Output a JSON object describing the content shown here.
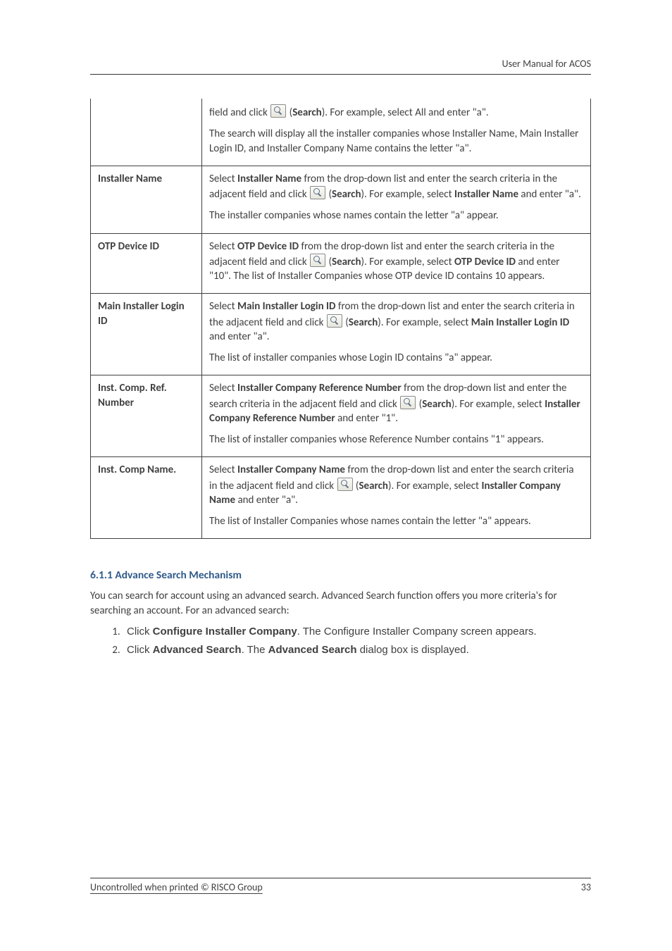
{
  "header": {
    "running_title": "User Manual for ACOS"
  },
  "table": {
    "rows": [
      {
        "label": "",
        "paras": [
          {
            "segs": [
              {
                "t": "field and click "
              },
              {
                "icon": "search"
              },
              {
                "t": " ("
              },
              {
                "b": "Search"
              },
              {
                "t": "). For example, select All and enter \"a\"."
              }
            ]
          },
          {
            "segs": [
              {
                "t": "The search will display all the installer companies whose Installer Name, Main Installer Login ID, and Installer Company Name contains the letter \"a\"."
              }
            ]
          }
        ]
      },
      {
        "label": "Installer Name",
        "paras": [
          {
            "segs": [
              {
                "t": "Select "
              },
              {
                "b": "Installer Name"
              },
              {
                "t": " from the drop-down list and enter the search criteria in the adjacent field and click "
              },
              {
                "icon": "search"
              },
              {
                "t": " ("
              },
              {
                "b": "Search"
              },
              {
                "t": "). For example, select "
              },
              {
                "b": "Installer Name"
              },
              {
                "t": " and enter \"a\"."
              }
            ]
          },
          {
            "segs": [
              {
                "t": "The installer companies whose names contain the letter \"a\" appear."
              }
            ]
          }
        ]
      },
      {
        "label": "OTP Device ID",
        "paras": [
          {
            "segs": [
              {
                "t": "Select "
              },
              {
                "b": "OTP Device ID"
              },
              {
                "t": " from the drop-down list and enter the search criteria in the adjacent field and click "
              },
              {
                "icon": "search"
              },
              {
                "t": " ("
              },
              {
                "b": "Search"
              },
              {
                "t": "). For example, select "
              },
              {
                "b": "OTP Device ID"
              },
              {
                "t": " and enter \"10\". The list of Installer Companies whose OTP device ID contains 10 appears."
              }
            ]
          }
        ]
      },
      {
        "label": "Main Installer Login ID",
        "paras": [
          {
            "segs": [
              {
                "t": "Select "
              },
              {
                "b": "Main Installer Login ID"
              },
              {
                "t": " from the drop-down list and enter the search criteria in the adjacent field and click "
              },
              {
                "icon": "search"
              },
              {
                "t": " ("
              },
              {
                "b": "Search"
              },
              {
                "t": "). For example, select "
              },
              {
                "b": "Main Installer Login ID"
              },
              {
                "t": " and enter \"a\"."
              }
            ]
          },
          {
            "segs": [
              {
                "t": "The list of installer companies whose Login ID contains \"a\" appear."
              }
            ]
          }
        ]
      },
      {
        "label": "Inst. Comp. Ref. Number",
        "paras": [
          {
            "segs": [
              {
                "t": "Select "
              },
              {
                "b": "Installer Company Reference Number"
              },
              {
                "t": " from the drop-down list and enter the search criteria in the adjacent field and click "
              },
              {
                "icon": "search"
              },
              {
                "t": " ("
              },
              {
                "b": "Search"
              },
              {
                "t": "). For example, select "
              },
              {
                "b": "Installer Company Reference Number"
              },
              {
                "t": " and enter \"1\"."
              }
            ]
          },
          {
            "segs": [
              {
                "t": "The list of installer companies whose Reference Number contains \"1\" appears."
              }
            ]
          }
        ]
      },
      {
        "label": "Inst. Comp Name.",
        "paras": [
          {
            "segs": [
              {
                "t": "Select "
              },
              {
                "b": "Installer Company Name"
              },
              {
                "t": " from the drop-down list and enter the search criteria in the adjacent field and click "
              },
              {
                "icon": "search"
              },
              {
                "t": " ("
              },
              {
                "b": "Search"
              },
              {
                "t": "). For example, select "
              },
              {
                "b": "Installer Company Name"
              },
              {
                "t": " and enter \"a\"."
              }
            ]
          },
          {
            "segs": [
              {
                "t": "The list of Installer Companies whose names contain the letter \"a\" appears."
              }
            ]
          }
        ]
      }
    ]
  },
  "section": {
    "heading": "6.1.1  Advance Search Mechanism",
    "intro": "You can search for account using an advanced search. Advanced Search function offers you more criteria's for searching an account. For an advanced search:",
    "steps": [
      {
        "segs": [
          {
            "t": "Click "
          },
          {
            "b": "Configure Installer Company"
          },
          {
            "t": ". The Configure Installer Company screen appears."
          }
        ]
      },
      {
        "segs": [
          {
            "t": "Click "
          },
          {
            "b": "Advanced Search"
          },
          {
            "t": ". The "
          },
          {
            "b": "Advanced Search"
          },
          {
            "t": " dialog box is displayed."
          }
        ]
      }
    ]
  },
  "footer": {
    "left": "Uncontrolled when printed © RISCO Group",
    "right": "33"
  }
}
